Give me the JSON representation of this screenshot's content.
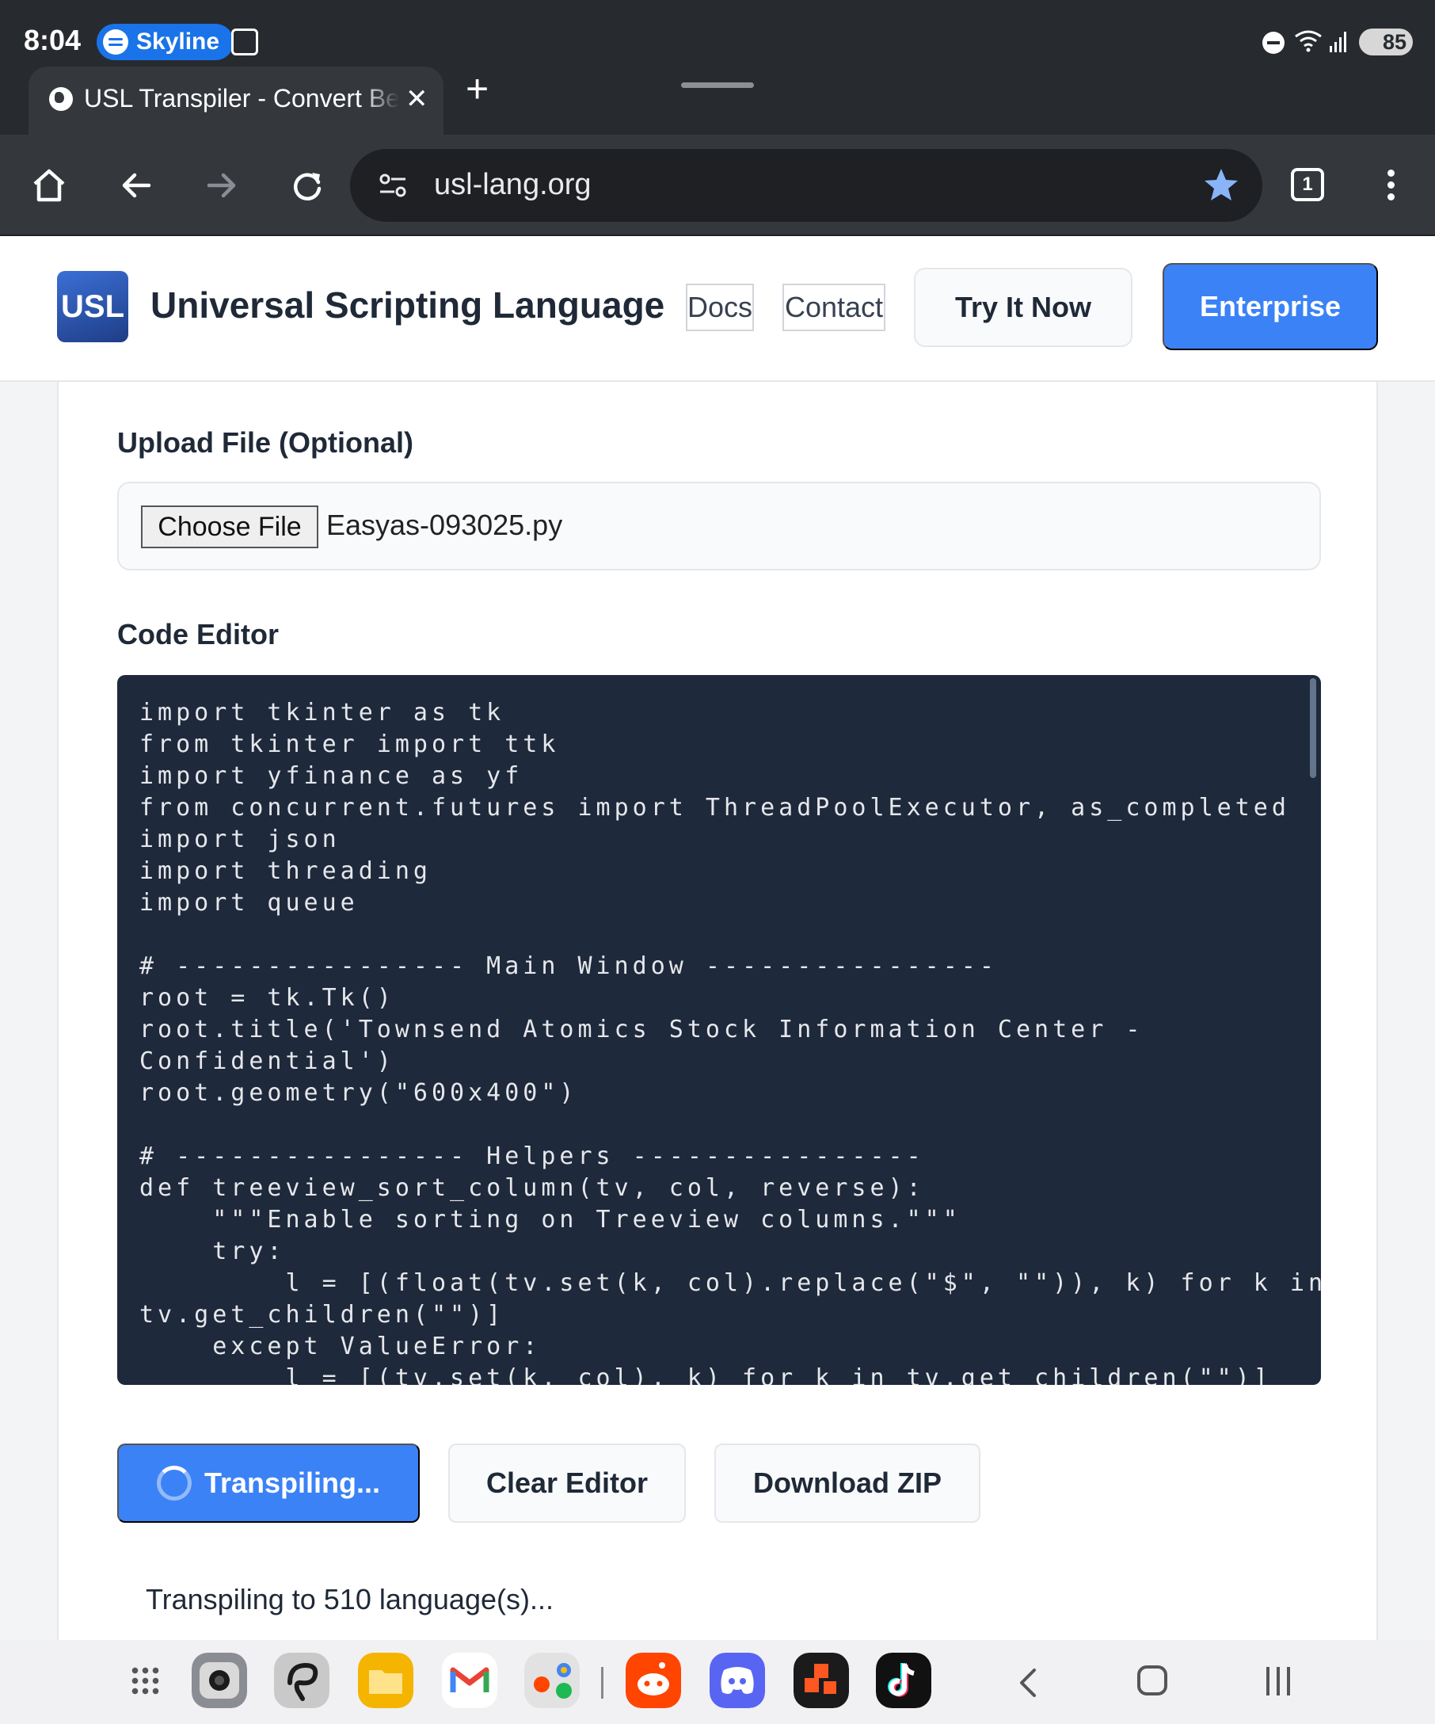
{
  "status_bar": {
    "time": "8:04",
    "media_app": "Skyline",
    "battery": "85",
    "icons": [
      "screenshot-icon",
      "do-not-disturb-icon",
      "wifi-icon",
      "signal-icon",
      "battery-icon"
    ]
  },
  "browser": {
    "tab_title": "USL Transpiler - Convert Be",
    "tab_count": "1",
    "url": "usl-lang.org",
    "toolbar_icons": [
      "home-icon",
      "back-icon",
      "forward-icon",
      "reload-icon",
      "site-settings-icon",
      "bookmark-star-icon",
      "tab-switcher-icon",
      "menu-icon"
    ]
  },
  "header": {
    "logo": "USL",
    "site_name": "Universal Scripting Language",
    "nav": {
      "docs": "Docs",
      "contact": "Contact"
    },
    "try_button": "Try It Now",
    "enterprise_button": "Enterprise"
  },
  "upload": {
    "label": "Upload File (Optional)",
    "button": "Choose File",
    "file_name": "Easyas-093025.py"
  },
  "editor": {
    "label": "Code Editor",
    "code": "import tkinter as tk\nfrom tkinter import ttk\nimport yfinance as yf\nfrom concurrent.futures import ThreadPoolExecutor, as_completed\nimport json\nimport threading\nimport queue\n\n# ---------------- Main Window ----------------\nroot = tk.Tk()\nroot.title('Townsend Atomics Stock Information Center -\nConfidential')\nroot.geometry(\"600x400\")\n\n# ---------------- Helpers ----------------\ndef treeview_sort_column(tv, col, reverse):\n    \"\"\"Enable sorting on Treeview columns.\"\"\"\n    try:\n        l = [(float(tv.set(k, col).replace(\"$\", \"\")), k) for k in\ntv.get_children(\"\")]\n    except ValueError:\n        l = [(tv.set(k, col), k) for k in tv.get_children(\"\")]"
  },
  "actions": {
    "transpile": "Transpiling...",
    "clear": "Clear Editor",
    "download": "Download ZIP"
  },
  "status": "Transpiling to 510 language(s)...",
  "taskbar": {
    "apps": [
      "camera-app-icon",
      "lasso-app-icon",
      "files-app-icon",
      "gmail-app-icon",
      "app-folder-icon",
      "reddit-app-icon",
      "discord-app-icon",
      "shortcut-app-icon",
      "tiktok-app-icon"
    ],
    "app_colors": {
      "camera": "#8a8d93",
      "lasso": "#c9c9c9",
      "files": "#f4b400",
      "gmail": "#ffffff",
      "folder": "#e2e2e2",
      "reddit": "#ff4500",
      "discord": "#5865f2",
      "shortcut": "#1b1b1b",
      "tiktok": "#111111"
    }
  },
  "colors": {
    "accent": "#3b82f6",
    "editor_bg": "#1e293b",
    "browser_chrome": "#34373c"
  }
}
